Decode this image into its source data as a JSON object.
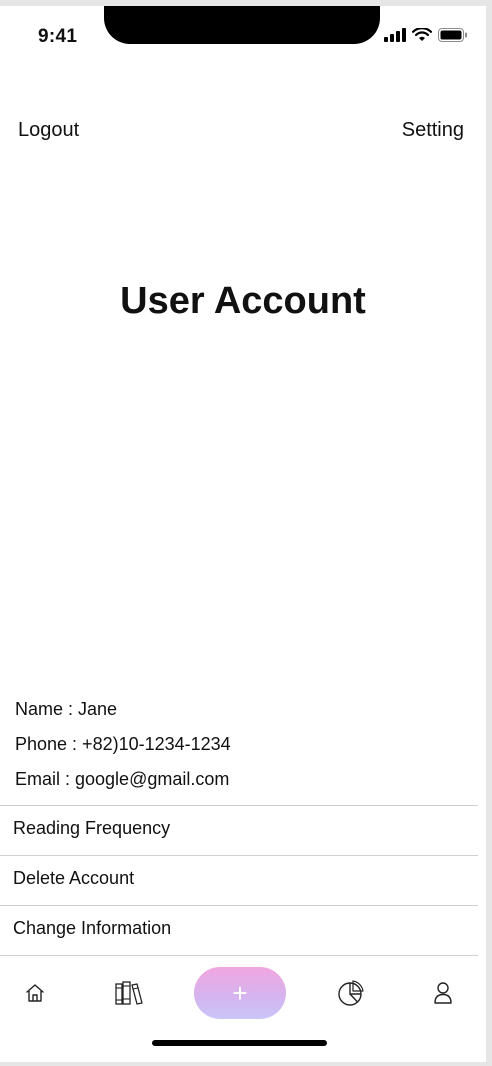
{
  "status_bar": {
    "time": "9:41"
  },
  "header": {
    "logout_label": "Logout",
    "setting_label": "Setting"
  },
  "main": {
    "title": "User Account"
  },
  "user_info": {
    "name": "Name : Jane",
    "phone": "Phone : +82)10-1234-1234",
    "email": "Email : google@gmail.com"
  },
  "menu": {
    "items": [
      {
        "label": "Reading Frequency"
      },
      {
        "label": "Delete Account"
      },
      {
        "label": "Change Information"
      }
    ]
  },
  "tab_bar": {
    "items": [
      {
        "icon": "home-icon"
      },
      {
        "icon": "books-icon"
      },
      {
        "icon": "plus-icon",
        "label": "+"
      },
      {
        "icon": "pie-chart-icon"
      },
      {
        "icon": "user-icon"
      }
    ],
    "add_gradient": [
      "#f0a6e0",
      "#c9c6f7"
    ]
  }
}
